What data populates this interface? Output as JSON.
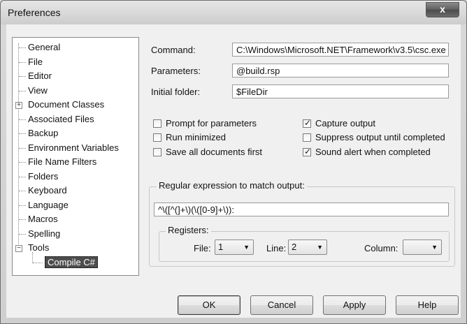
{
  "window": {
    "title": "Preferences",
    "close_label": "x"
  },
  "tree": {
    "items": [
      {
        "label": "General"
      },
      {
        "label": "File"
      },
      {
        "label": "Editor"
      },
      {
        "label": "View"
      },
      {
        "label": "Document Classes",
        "expander": "+"
      },
      {
        "label": "Associated Files"
      },
      {
        "label": "Backup"
      },
      {
        "label": "Environment Variables"
      },
      {
        "label": "File Name Filters"
      },
      {
        "label": "Folders"
      },
      {
        "label": "Keyboard"
      },
      {
        "label": "Language"
      },
      {
        "label": "Macros"
      },
      {
        "label": "Spelling"
      },
      {
        "label": "Tools",
        "expander": "−"
      },
      {
        "label": "Compile C#",
        "selected": true
      }
    ]
  },
  "form": {
    "command_label": "Command:",
    "command_value": "C:\\Windows\\Microsoft.NET\\Framework\\v3.5\\csc.exe",
    "parameters_label": "Parameters:",
    "parameters_value": "@build.rsp",
    "folder_label": "Initial folder:",
    "folder_value": "$FileDir"
  },
  "options": {
    "prompt": {
      "label": "Prompt for parameters",
      "checked": false
    },
    "minimized": {
      "label": "Run minimized",
      "checked": false
    },
    "save_all": {
      "label": "Save all documents first",
      "checked": false
    },
    "capture": {
      "label": "Capture output",
      "checked": true
    },
    "suppress": {
      "label": "Suppress output until completed",
      "checked": false
    },
    "sound": {
      "label": "Sound alert when completed",
      "checked": true
    }
  },
  "regex": {
    "group_title": "Regular expression to match output:",
    "value": "^\\([^(]+\\)(\\([0-9]+\\)):",
    "registers_title": "Registers:",
    "file_label": "File:",
    "file_value": "1",
    "line_label": "Line:",
    "line_value": "2",
    "column_label": "Column:",
    "column_value": ""
  },
  "buttons": {
    "ok": "OK",
    "cancel": "Cancel",
    "apply": "Apply",
    "help": "Help"
  }
}
